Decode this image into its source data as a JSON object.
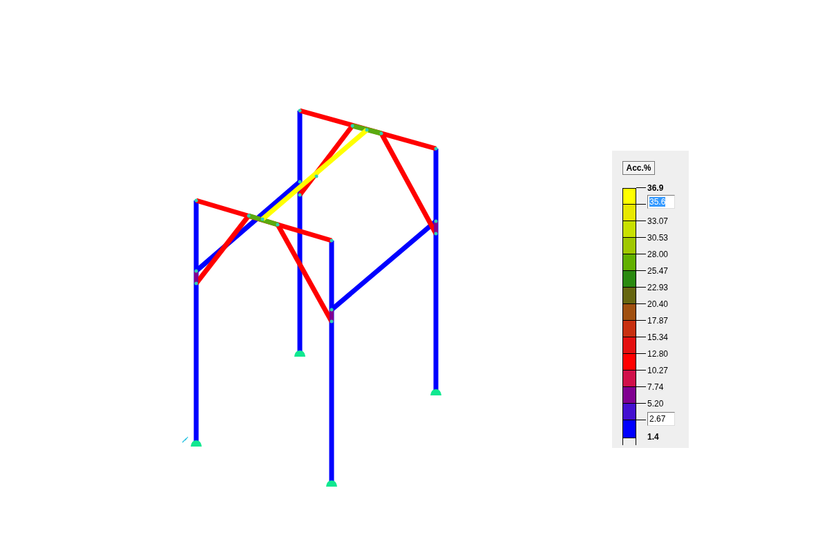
{
  "legend": {
    "title": "Acc.%",
    "max_label": "36.9",
    "max_field": {
      "value": "35.6",
      "selected": true
    },
    "bands": [
      {
        "color": "#ffff00"
      },
      {
        "color": "#e8e800"
      },
      {
        "color": "#c8e000"
      },
      {
        "color": "#a0c800"
      },
      {
        "color": "#62b000"
      },
      {
        "color": "#2a8a10"
      },
      {
        "color": "#666610"
      },
      {
        "color": "#a05010"
      },
      {
        "color": "#c83010"
      },
      {
        "color": "#e41010"
      },
      {
        "color": "#ff0000"
      },
      {
        "color": "#d0104a"
      },
      {
        "color": "#800090"
      },
      {
        "color": "#4410d0"
      },
      {
        "color": "#0000ff"
      }
    ],
    "tick_labels": [
      "33.07",
      "30.53",
      "28.00",
      "25.47",
      "22.93",
      "20.40",
      "17.87",
      "15.34",
      "12.80",
      "10.27",
      "7.74",
      "5.20"
    ],
    "min_field": {
      "value": "2.67",
      "selected": false
    },
    "min_label": "1.4"
  }
}
